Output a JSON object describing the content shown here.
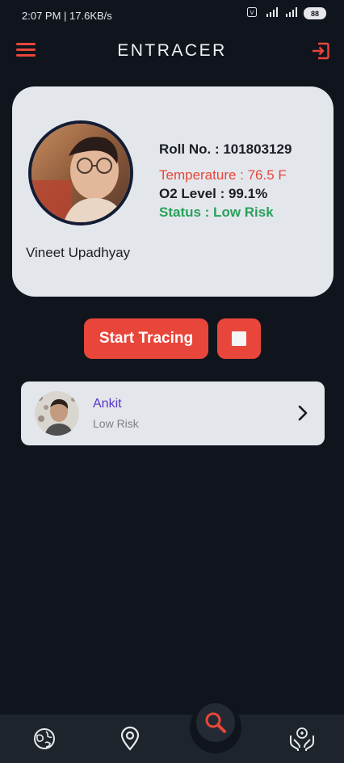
{
  "status_bar": {
    "time_speed": "2:07 PM | 17.6KB/s",
    "battery": "88"
  },
  "app_bar": {
    "title": "ENTRACER"
  },
  "profile": {
    "name": "Vineet Upadhyay",
    "roll": "Roll No. : 101803129",
    "temperature": "Temperature : 76.5 F",
    "o2_level": "O2 Level : 99.1%",
    "status": "Status : Low Risk"
  },
  "controls": {
    "start_label": "Start Tracing"
  },
  "contacts": [
    {
      "name": "Ankit",
      "risk": "Low Risk"
    }
  ],
  "colors": {
    "accent": "#e8463a",
    "background": "#10151d",
    "card": "#e3e7ec",
    "status_green": "#2aa05a",
    "contact_name": "#5a34c4"
  },
  "icons": {
    "menu": "hamburger-icon",
    "logout": "logout-icon",
    "stop": "stop-icon",
    "chevron": "chevron-right-icon",
    "nav": [
      "globe-icon",
      "location-pin-icon",
      "search-icon",
      "hands-icon"
    ]
  }
}
